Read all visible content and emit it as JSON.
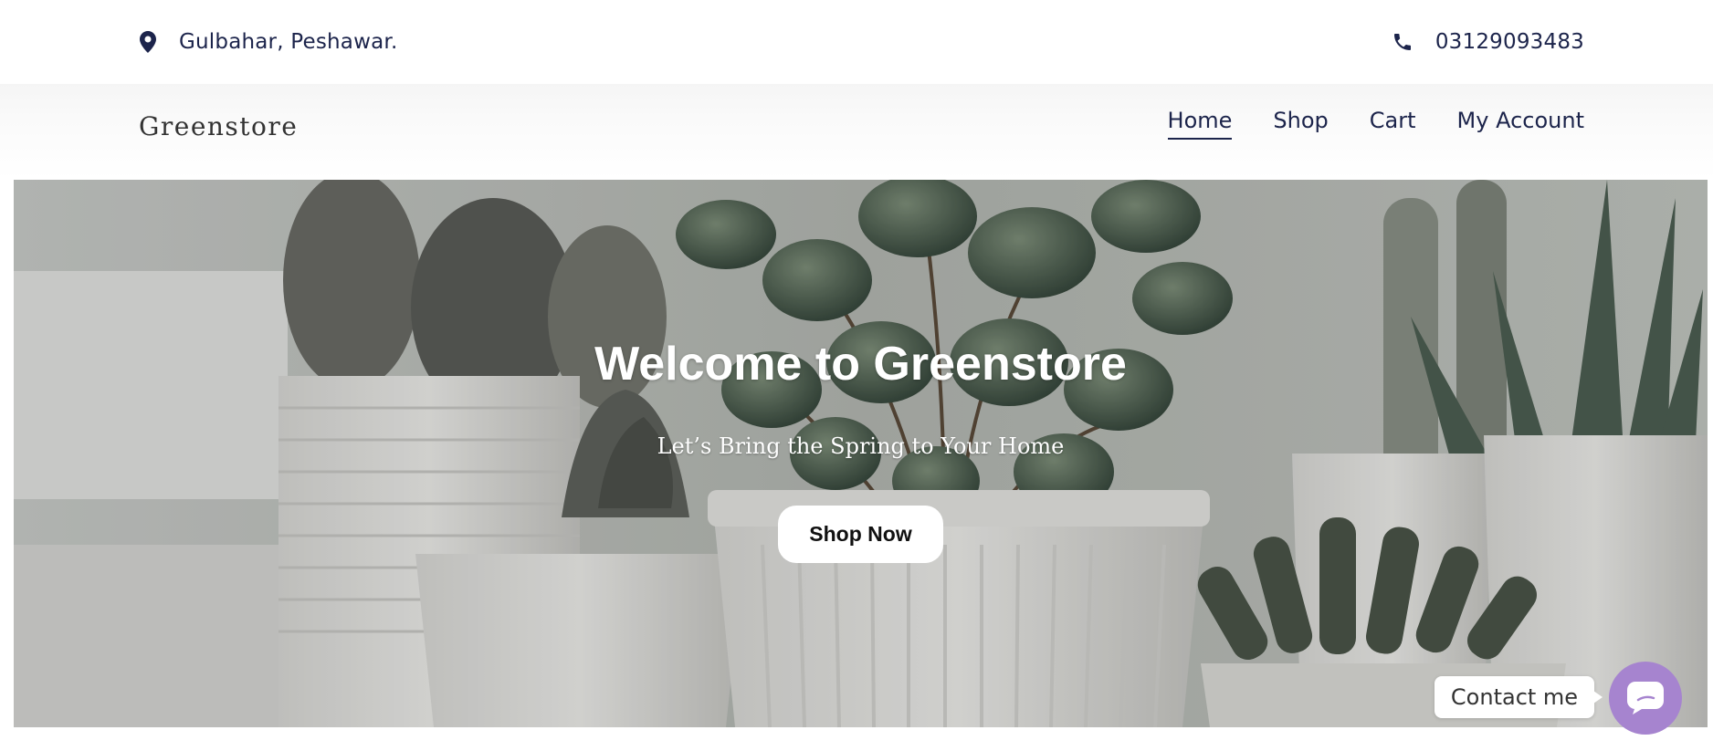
{
  "topbar": {
    "location_icon": "map-pin-icon",
    "location": "Gulbahar, Peshawar.",
    "phone_icon": "phone-icon",
    "phone": "03129093483"
  },
  "header": {
    "logo": "Greenstore",
    "nav": [
      {
        "label": "Home",
        "active": true
      },
      {
        "label": "Shop",
        "active": false
      },
      {
        "label": "Cart",
        "active": false
      },
      {
        "label": "My Account",
        "active": false
      }
    ]
  },
  "hero": {
    "title": "Welcome to Greenstore",
    "subtitle": "Let’s Bring the Spring to Your Home",
    "cta_label": "Shop Now",
    "background": "potted-plants-photo"
  },
  "contact_widget": {
    "label": "Contact me",
    "icon": "chat-icon",
    "color": "#a684cf"
  },
  "colors": {
    "nav_text": "#1c244b",
    "button_bg": "#ffffff",
    "accent": "#a684cf"
  }
}
